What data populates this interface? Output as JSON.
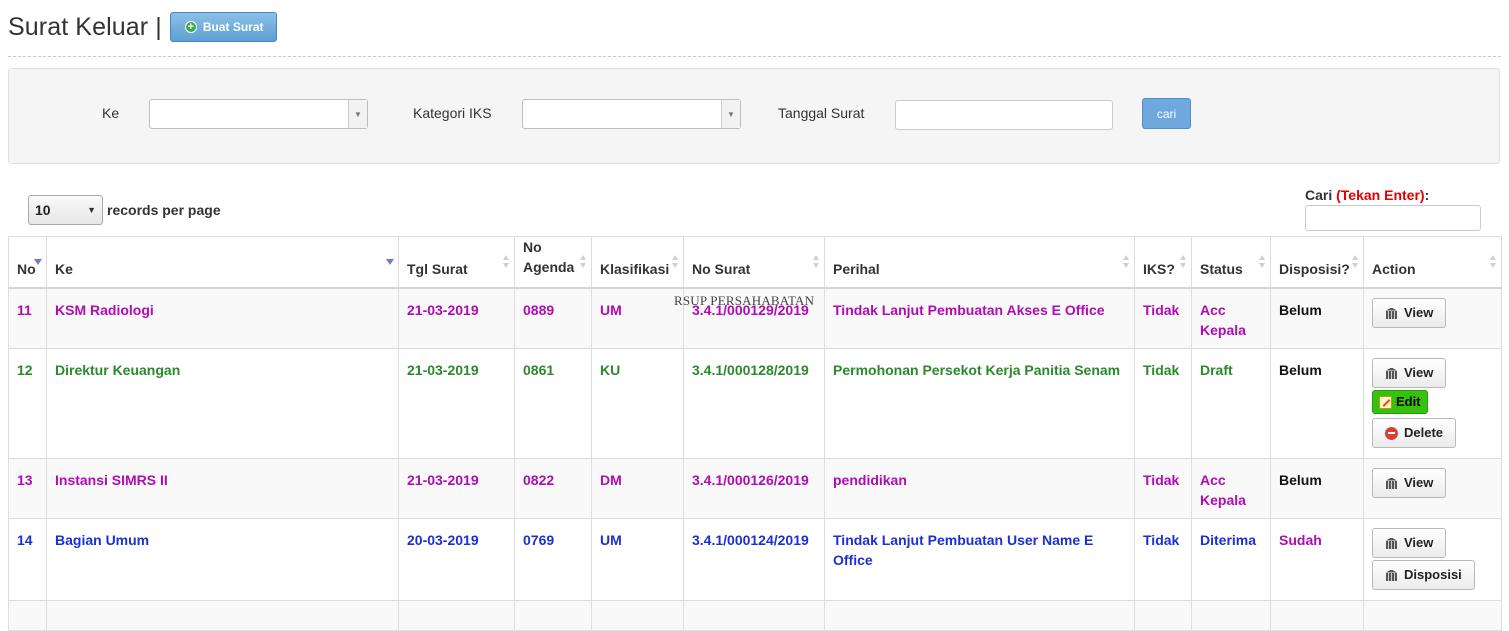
{
  "header": {
    "title": "Surat Keluar |",
    "create_button": "Buat Surat"
  },
  "filters": {
    "ke_label": "Ke",
    "kategori_label": "Kategori IKS",
    "tanggal_label": "Tanggal Surat",
    "search_button": "cari"
  },
  "table_controls": {
    "page_length_value": "10",
    "page_length_text": "records per page",
    "search_label": "Cari",
    "search_hint": "(Tekan Enter)",
    "search_colon": ":"
  },
  "watermark": "RSUP PERSAHABATAN",
  "columns": [
    "No",
    "Ke",
    "Tgl Surat",
    "No Agenda",
    "Klasifikasi",
    "No Surat",
    "Perihal",
    "IKS?",
    "Status",
    "Disposisi?",
    "Action"
  ],
  "rows": [
    {
      "no": "11",
      "ke": "KSM Radiologi",
      "tgl": "21-03-2019",
      "agenda": "0889",
      "klasifikasi": "UM",
      "no_surat": "3.4.1/000129/2019",
      "perihal": "Tindak Lanjut Pembuatan Akses E Office",
      "iks": "Tidak",
      "status": "Acc Kepala",
      "disposisi": "Belum",
      "color": "#b00bb5",
      "actions": [
        "View"
      ]
    },
    {
      "no": "12",
      "ke": "Direktur Keuangan",
      "tgl": "21-03-2019",
      "agenda": "0861",
      "klasifikasi": "KU",
      "no_surat": "3.4.1/000128/2019",
      "perihal": "Permohonan Persekot Kerja Panitia Senam",
      "iks": "Tidak",
      "status": "Draft",
      "disposisi": "Belum",
      "color": "#2a8a2a",
      "actions": [
        "View",
        "Edit",
        "Delete"
      ]
    },
    {
      "no": "13",
      "ke": "Instansi SIMRS II",
      "tgl": "21-03-2019",
      "agenda": "0822",
      "klasifikasi": "DM",
      "no_surat": "3.4.1/000126/2019",
      "perihal": "pendidikan",
      "iks": "Tidak",
      "status": "Acc Kepala",
      "disposisi": "Belum",
      "color": "#b00bb5",
      "actions": [
        "View"
      ]
    },
    {
      "no": "14",
      "ke": "Bagian Umum",
      "tgl": "20-03-2019",
      "agenda": "0769",
      "klasifikasi": "UM",
      "no_surat": "3.4.1/000124/2019",
      "perihal": "Tindak Lanjut Pembuatan User Name E Office",
      "iks": "Tidak",
      "status": "Diterima",
      "disposisi": "Sudah",
      "color": "#1b2fd4",
      "actions": [
        "View",
        "Disposisi"
      ]
    }
  ],
  "colors": {
    "purple": "#b00bb5",
    "green": "#2a8a2a",
    "blue": "#1b2fd4",
    "button_blue": "#6fa8dc",
    "edit_green": "#35c20f",
    "required_red": "#e10000"
  }
}
